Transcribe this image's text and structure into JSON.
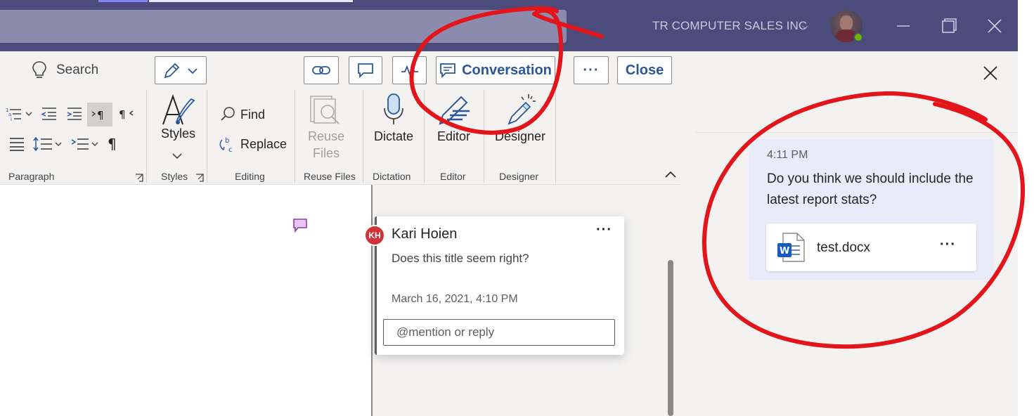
{
  "titlebar": {
    "org_name": "TR COMPUTER SALES INC",
    "org_chevron": "⌵"
  },
  "ribbon": {
    "search_label": "Search",
    "toolbar": {
      "conversation_label": "Conversation",
      "more_label": "···",
      "close_label": "Close"
    },
    "groups": {
      "paragraph": "Paragraph",
      "styles": "Styles",
      "editing": "Editing",
      "reuse_files": "Reuse Files",
      "dictation": "Dictation",
      "editor": "Editor",
      "designer": "Designer"
    },
    "buttons": {
      "styles": "Styles",
      "find": "Find",
      "replace": "Replace",
      "reuse_line1": "Reuse",
      "reuse_line2": "Files",
      "dictate": "Dictate",
      "editor": "Editor",
      "designer": "Designer"
    }
  },
  "comment": {
    "initials": "KH",
    "author": "Kari Hoien",
    "more": "···",
    "text": "Does this title seem right?",
    "date": "March 16, 2021, 4:10 PM",
    "reply_placeholder": "@mention or reply"
  },
  "chat": {
    "time": "4:11 PM",
    "message": "Do you think we should include the latest report stats?",
    "file_name": "test.docx",
    "file_more": "···"
  },
  "colors": {
    "titlebar": "#4b4b7c",
    "accent_blue": "#2b579a",
    "annotation_red": "#e3151a",
    "avatar_badge": "#d13438",
    "bubble": "#e8ebfa"
  }
}
